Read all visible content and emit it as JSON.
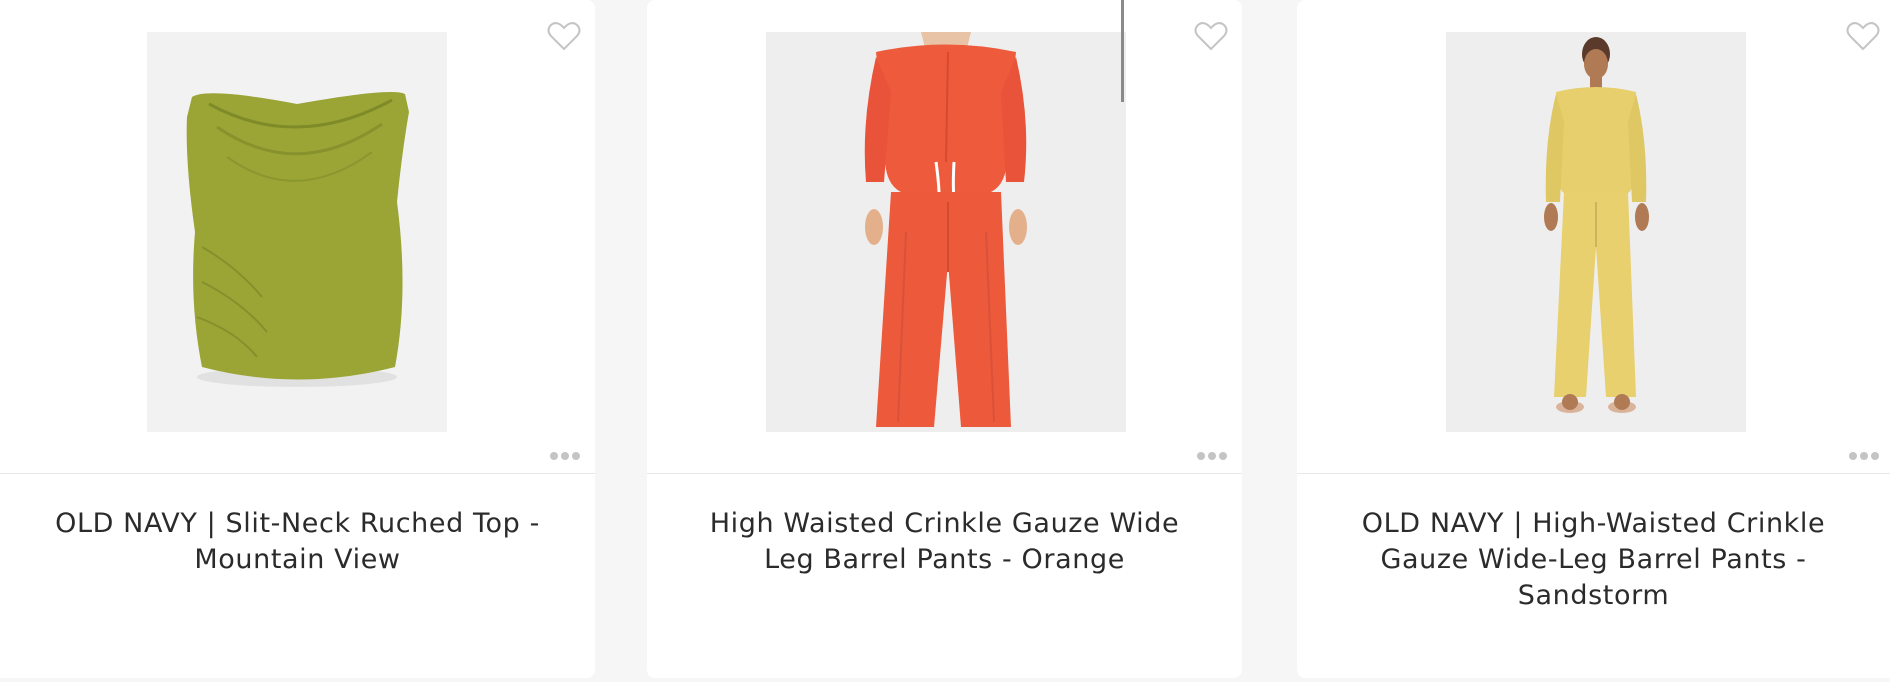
{
  "products": [
    {
      "title": "OLD NAVY | Slit-Neck Ruched Top - Mountain View",
      "image": "green sleeveless ruched top",
      "color": "#9aa536"
    },
    {
      "title": "High Waisted Crinkle Gauze Wide Leg Barrel Pants - Orange",
      "image": "model in orange shirt and wide leg pants",
      "color": "#ee5a3c"
    },
    {
      "title": "OLD NAVY | High-Waisted Crinkle Gauze Wide-Leg Barrel Pants - Sandstorm",
      "image": "model in yellow shirt and wide leg pants",
      "color": "#e6cf6c"
    }
  ],
  "icons": {
    "favorite": "heart-outline-icon",
    "more": "more-dots-icon"
  },
  "colors": {
    "background": "#f6f6f6",
    "card": "#ffffff",
    "text": "#2b2b2b",
    "icon": "#c4c4c4"
  }
}
